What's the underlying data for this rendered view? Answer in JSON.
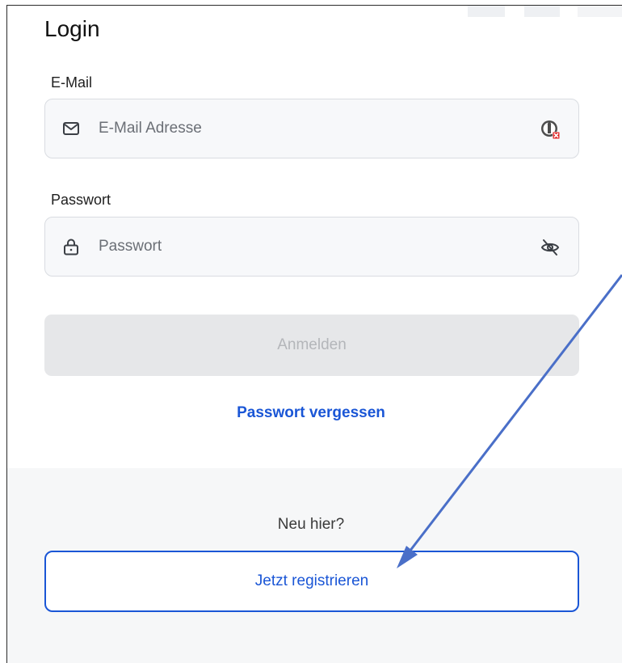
{
  "login": {
    "title": "Login",
    "email": {
      "label": "E-Mail",
      "placeholder": "E-Mail Adresse",
      "value": "",
      "icon": "envelope-icon",
      "trailing_icon": "password-manager-blocked-icon"
    },
    "password": {
      "label": "Passwort",
      "placeholder": "Passwort",
      "value": "",
      "icon": "lock-icon",
      "trailing_icon": "eye-slash-icon"
    },
    "submit_label": "Anmelden",
    "submit_enabled": false,
    "forgot_label": "Passwort vergessen"
  },
  "signup": {
    "prompt": "Neu hier?",
    "button_label": "Jetzt registrieren"
  },
  "colors": {
    "accent": "#1a56d6",
    "annotation_arrow": "#4a6fc8",
    "disabled_button_bg": "#e6e7e9",
    "disabled_button_text": "#b4b6ba"
  }
}
